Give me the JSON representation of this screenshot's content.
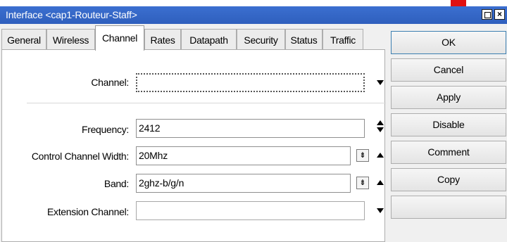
{
  "window": {
    "title": "Interface <cap1-Routeur-Staff>"
  },
  "tabs": [
    "General",
    "Wireless",
    "Channel",
    "Rates",
    "Datapath",
    "Security",
    "Status",
    "Traffic"
  ],
  "active_tab": "Channel",
  "fields": {
    "channel": {
      "label": "Channel:",
      "value": ""
    },
    "frequency": {
      "label": "Frequency:",
      "value": "2412"
    },
    "control_channel_width": {
      "label": "Control Channel Width:",
      "value": "20Mhz"
    },
    "band": {
      "label": "Band:",
      "value": "2ghz-b/g/n"
    },
    "extension_channel": {
      "label": "Extension Channel:",
      "value": ""
    }
  },
  "buttons": {
    "ok": "OK",
    "cancel": "Cancel",
    "apply": "Apply",
    "disable": "Disable",
    "comment": "Comment",
    "copy": "Copy"
  },
  "colors": {
    "titlebar": "#2f5fbd",
    "accent_mark": "#e01010"
  }
}
